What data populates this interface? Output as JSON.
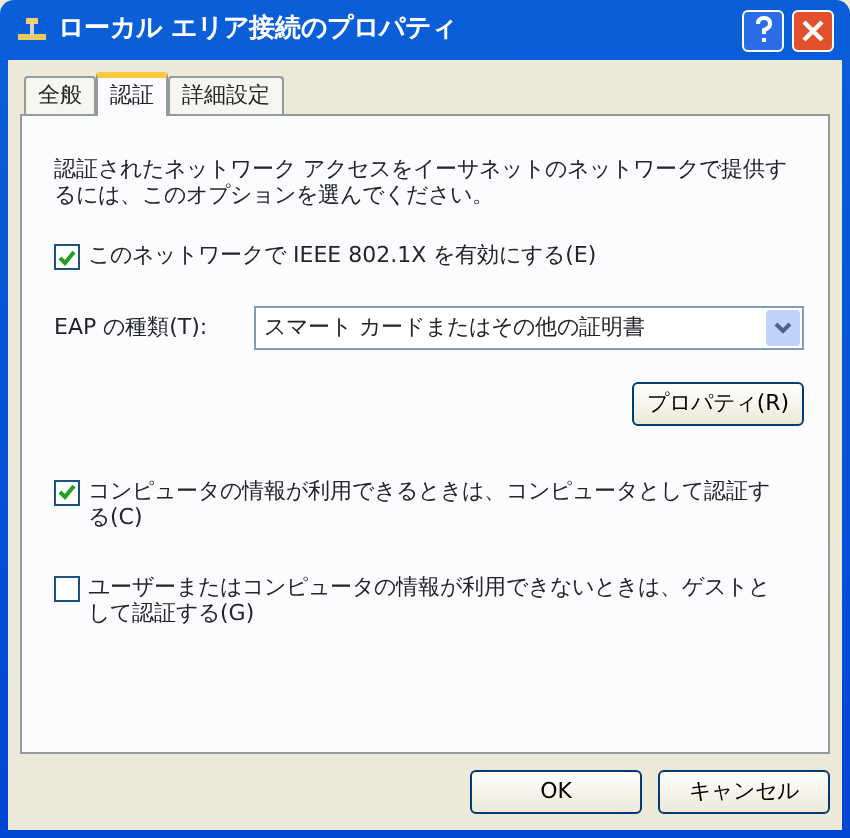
{
  "window": {
    "title": "ローカル エリア接続のプロパティ"
  },
  "tabs": [
    {
      "label": "全般",
      "selected": false
    },
    {
      "label": "認証",
      "selected": true
    },
    {
      "label": "詳細設定",
      "selected": false
    }
  ],
  "description": "認証されたネットワーク アクセスをイーサネットのネットワークで提供するには、このオプションを選んでください。",
  "enable_8021x": {
    "label": "このネットワークで IEEE 802.1X を有効にする(E)",
    "checked": true
  },
  "eap_type": {
    "label": "EAP の種類(T):",
    "value": "スマート カードまたはその他の証明書"
  },
  "properties_button": "プロパティ(R)",
  "options": [
    {
      "label": "コンピュータの情報が利用できるときは、コンピュータとして認証する(C)",
      "checked": true
    },
    {
      "label": "ユーザーまたはコンピュータの情報が利用できないときは、ゲストとして認証する(G)",
      "checked": false
    }
  ],
  "buttons": [
    "OK",
    "キャンセル"
  ]
}
